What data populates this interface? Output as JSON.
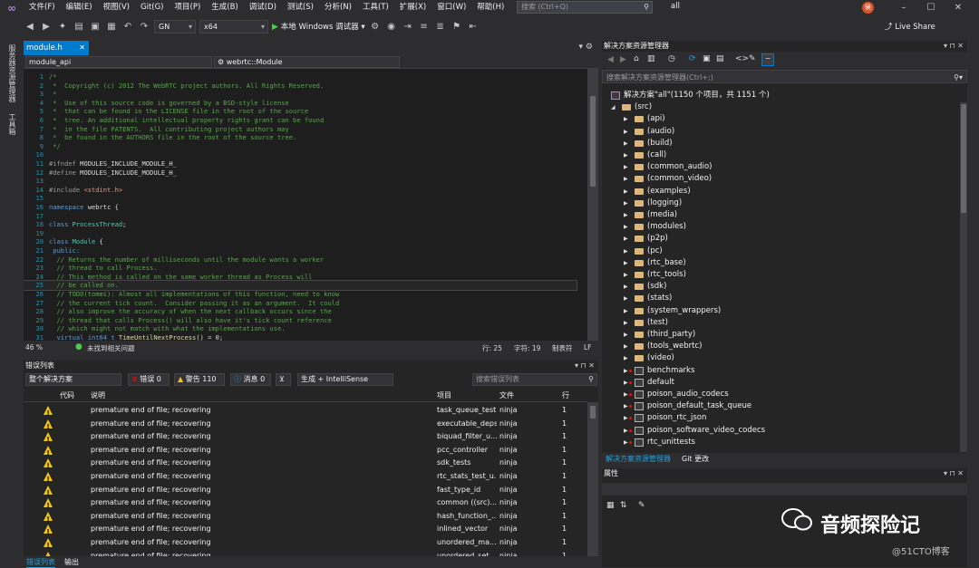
{
  "menubar": {
    "items": [
      "文件(F)",
      "编辑(E)",
      "视图(V)",
      "Git(G)",
      "项目(P)",
      "生成(B)",
      "调试(D)",
      "测试(S)",
      "分析(N)",
      "工具(T)",
      "扩展(X)",
      "窗口(W)",
      "帮助(H)"
    ],
    "search_placeholder": "搜索 (Ctrl+Q)",
    "project_name": "all",
    "avatar": "侯"
  },
  "toolbar": {
    "config": "GN",
    "platform": "x64",
    "run_label": "本地 Windows 调试器",
    "live_share": "Live Share"
  },
  "left_tabs": [
    "服务器资源管理器",
    "工具箱"
  ],
  "editor": {
    "tab": "module.h",
    "nav_left": "module_api",
    "nav_right": "webrtc::Module",
    "zoom": "46 %",
    "status": "未找到相关问题",
    "line": "行: 25",
    "col": "字符: 19",
    "tabs": "制表符",
    "eol": "LF",
    "lines": [
      {
        "n": "1",
        "parts": [
          {
            "t": "/*",
            "k": "cc"
          }
        ]
      },
      {
        "n": "2",
        "parts": [
          {
            "t": " *  Copyright (c) 2012 The WebRTC project authors. All Rights Reserved.",
            "k": "cc"
          }
        ]
      },
      {
        "n": "3",
        "parts": [
          {
            "t": " *",
            "k": "cc"
          }
        ]
      },
      {
        "n": "4",
        "parts": [
          {
            "t": " *  Use of this source code is governed by a BSD-style license",
            "k": "cc"
          }
        ]
      },
      {
        "n": "5",
        "parts": [
          {
            "t": " *  that can be found in the LICENSE file in the root of the source",
            "k": "cc"
          }
        ]
      },
      {
        "n": "6",
        "parts": [
          {
            "t": " *  tree. An additional intellectual property rights grant can be found",
            "k": "cc"
          }
        ]
      },
      {
        "n": "7",
        "parts": [
          {
            "t": " *  in the file PATENTS.  All contributing project authors may",
            "k": "cc"
          }
        ]
      },
      {
        "n": "8",
        "parts": [
          {
            "t": " *  be found in the AUTHORS file in the root of the source tree.",
            "k": "cc"
          }
        ]
      },
      {
        "n": "9",
        "parts": [
          {
            "t": " */",
            "k": "cc"
          }
        ]
      },
      {
        "n": "10",
        "parts": []
      },
      {
        "n": "11",
        "parts": [
          {
            "t": "#ifndef ",
            "k": "pp"
          },
          {
            "t": "MODULES_INCLUDE_MODULE_H_",
            "k": "tx"
          }
        ]
      },
      {
        "n": "12",
        "parts": [
          {
            "t": "#define ",
            "k": "pp"
          },
          {
            "t": "MODULES_INCLUDE_MODULE_H_",
            "k": "tx"
          }
        ]
      },
      {
        "n": "13",
        "parts": []
      },
      {
        "n": "14",
        "parts": [
          {
            "t": "#include ",
            "k": "pp"
          },
          {
            "t": "<stdint.h>",
            "k": "st"
          }
        ]
      },
      {
        "n": "15",
        "parts": []
      },
      {
        "n": "16",
        "parts": [
          {
            "t": "namespace ",
            "k": "kw"
          },
          {
            "t": "webrtc {",
            "k": "tx"
          }
        ]
      },
      {
        "n": "17",
        "parts": []
      },
      {
        "n": "18",
        "parts": [
          {
            "t": "class ",
            "k": "kw"
          },
          {
            "t": "ProcessThread",
            "k": "ty"
          },
          {
            "t": ";",
            "k": "tx"
          }
        ]
      },
      {
        "n": "19",
        "parts": []
      },
      {
        "n": "20",
        "parts": [
          {
            "t": "class ",
            "k": "kw"
          },
          {
            "t": "Module",
            "k": "ty"
          },
          {
            "t": " {",
            "k": "tx"
          }
        ]
      },
      {
        "n": "21",
        "parts": [
          {
            "t": " public:",
            "k": "kw"
          }
        ]
      },
      {
        "n": "22",
        "parts": [
          {
            "t": "  // Returns the number of milliseconds until the module wants a worker",
            "k": "cc"
          }
        ]
      },
      {
        "n": "23",
        "parts": [
          {
            "t": "  // thread to call Process.",
            "k": "cc"
          }
        ]
      },
      {
        "n": "24",
        "parts": [
          {
            "t": "  // This method is called on the same worker thread as Process will",
            "k": "cc"
          }
        ]
      },
      {
        "n": "25",
        "parts": [
          {
            "t": "  // be called on.",
            "k": "cc"
          }
        ]
      },
      {
        "n": "26",
        "parts": [
          {
            "t": "  // TODO(tommi): Almost all implementations of this function, need to know",
            "k": "cc"
          }
        ]
      },
      {
        "n": "27",
        "parts": [
          {
            "t": "  // the current tick count.  Consider passing it as an argument.  It could",
            "k": "cc"
          }
        ]
      },
      {
        "n": "28",
        "parts": [
          {
            "t": "  // also improve the accuracy of when the next callback occurs since the",
            "k": "cc"
          }
        ]
      },
      {
        "n": "29",
        "parts": [
          {
            "t": "  // thread that calls Process() will also have it's tick count reference",
            "k": "cc"
          }
        ]
      },
      {
        "n": "30",
        "parts": [
          {
            "t": "  // which might not match with what the implementations use.",
            "k": "cc"
          }
        ]
      },
      {
        "n": "31",
        "parts": [
          {
            "t": "  virtual ",
            "k": "kw"
          },
          {
            "t": "int64_t ",
            "k": "kw"
          },
          {
            "t": "TimeUntilNextProcess",
            "k": "fn"
          },
          {
            "t": "() = 0;",
            "k": "tx"
          }
        ]
      }
    ]
  },
  "error_list": {
    "title": "错误列表",
    "scope": "整个解决方案",
    "errors": "错误 0",
    "warnings": "警告 110",
    "messages": "消息 0",
    "build_filter": "生成 + IntelliSense",
    "search_placeholder": "搜索错误列表",
    "columns": [
      "代码",
      "说明",
      "项目",
      "文件",
      "行"
    ],
    "rows": [
      {
        "desc": "premature end of file; recovering",
        "proj": "task_queue_test",
        "file": "ninja",
        "line": "1"
      },
      {
        "desc": "premature end of file; recovering",
        "proj": "executable_deps",
        "file": "ninja",
        "line": "1"
      },
      {
        "desc": "premature end of file; recovering",
        "proj": "biquad_filter_u...",
        "file": "ninja",
        "line": "1"
      },
      {
        "desc": "premature end of file; recovering",
        "proj": "pcc_controller",
        "file": "ninja",
        "line": "1"
      },
      {
        "desc": "premature end of file; recovering",
        "proj": "sdk_tests",
        "file": "ninja",
        "line": "1"
      },
      {
        "desc": "premature end of file; recovering",
        "proj": "rtc_stats_test_u...",
        "file": "ninja",
        "line": "1"
      },
      {
        "desc": "premature end of file; recovering",
        "proj": "fast_type_id",
        "file": "ninja",
        "line": "1"
      },
      {
        "desc": "premature end of file; recovering",
        "proj": "common ((src)...",
        "file": "ninja",
        "line": "1"
      },
      {
        "desc": "premature end of file; recovering",
        "proj": "hash_function_...",
        "file": "ninja",
        "line": "1"
      },
      {
        "desc": "premature end of file; recovering",
        "proj": "inlined_vector",
        "file": "ninja",
        "line": "1"
      },
      {
        "desc": "premature end of file; recovering",
        "proj": "unordered_ma...",
        "file": "ninja",
        "line": "1"
      },
      {
        "desc": "premature end of file; recovering",
        "proj": "unordered_set...",
        "file": "ninja",
        "line": "1"
      }
    ],
    "bottom_tabs": [
      "错误列表",
      "输出"
    ]
  },
  "solution": {
    "title": "解决方案资源管理器",
    "search_placeholder": "搜索解决方案资源管理器(Ctrl+;)",
    "root": "解决方案\"all\"(1150 个项目，共 1151 个)",
    "src": "(src)",
    "folders": [
      "(api)",
      "(audio)",
      "(build)",
      "(call)",
      "(common_audio)",
      "(common_video)",
      "(examples)",
      "(logging)",
      "(media)",
      "(modules)",
      "(p2p)",
      "(pc)",
      "(rtc_base)",
      "(rtc_tools)",
      "(sdk)",
      "(stats)",
      "(system_wrappers)",
      "(test)",
      "(third_party)",
      "(tools_webrtc)",
      "(video)"
    ],
    "projects": [
      "benchmarks",
      "default",
      "poison_audio_codecs",
      "poison_default_task_queue",
      "poison_rtc_json",
      "poison_software_video_codecs",
      "rtc_unittests"
    ],
    "tabs": [
      "解决方案资源管理器",
      "Git 更改"
    ]
  },
  "properties": {
    "title": "属性"
  },
  "watermark": {
    "main": "音频探险记",
    "sub": "@51CTO博客"
  }
}
